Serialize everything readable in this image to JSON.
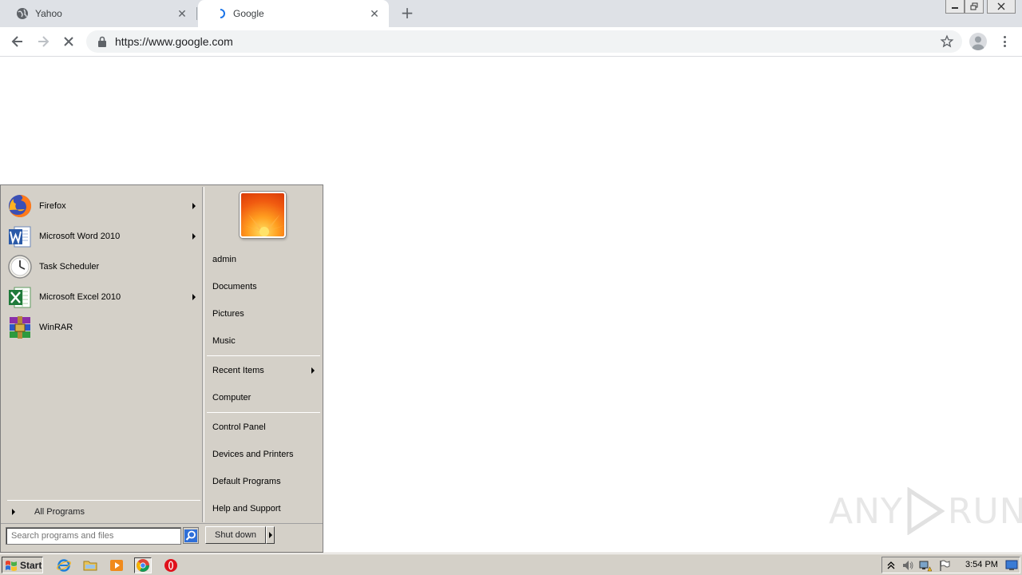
{
  "browser": {
    "tabs": [
      {
        "title": "Yahoo"
      },
      {
        "title": "Google"
      }
    ],
    "new_tab_label": "+",
    "address": "https://www.google.com"
  },
  "start_menu": {
    "programs": [
      {
        "label": "Firefox",
        "icon": "firefox-icon",
        "has_submenu": true
      },
      {
        "label": "Microsoft Word 2010",
        "icon": "word-icon",
        "has_submenu": true
      },
      {
        "label": "Task Scheduler",
        "icon": "clock-icon",
        "has_submenu": false
      },
      {
        "label": "Microsoft Excel 2010",
        "icon": "excel-icon",
        "has_submenu": true
      },
      {
        "label": "WinRAR",
        "icon": "winrar-icon",
        "has_submenu": false
      }
    ],
    "all_programs": "All Programs",
    "user_name": "admin",
    "places": [
      {
        "label": "Documents"
      },
      {
        "label": "Pictures"
      },
      {
        "label": "Music"
      },
      {
        "label": "Recent Items"
      },
      {
        "label": "Computer"
      },
      {
        "label": "Control Panel"
      },
      {
        "label": "Devices and Printers"
      },
      {
        "label": "Default Programs"
      },
      {
        "label": "Help and Support"
      }
    ],
    "search_placeholder": "Search programs and files",
    "shutdown_label": "Shut down"
  },
  "taskbar": {
    "start_label": "Start",
    "clock": "3:54 PM"
  },
  "watermark": {
    "left": "ANY",
    "right": "RUN"
  }
}
